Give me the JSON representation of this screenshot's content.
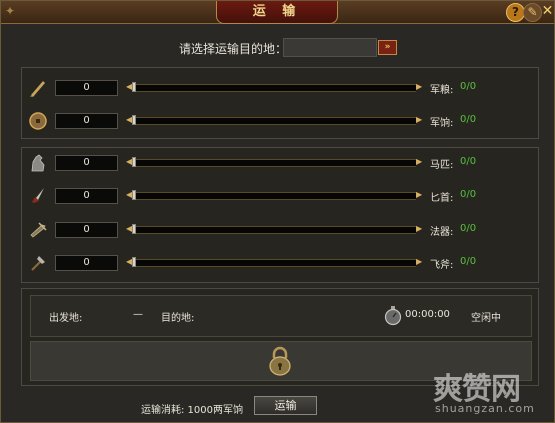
{
  "window": {
    "title": "运 输"
  },
  "destination": {
    "label": "请选择运输目的地：",
    "value": ""
  },
  "supplies": [
    {
      "name": "军粮:",
      "qty": "0",
      "value": "0/0",
      "icon": "brush-icon"
    },
    {
      "name": "军饷:",
      "qty": "0",
      "value": "0/0",
      "icon": "coin-icon"
    }
  ],
  "equipment": [
    {
      "name": "马匹:",
      "qty": "0",
      "value": "0/0",
      "icon": "horse-icon"
    },
    {
      "name": "匕首:",
      "qty": "0",
      "value": "0/0",
      "icon": "dagger-icon"
    },
    {
      "name": "法器:",
      "qty": "0",
      "value": "0/0",
      "icon": "crossbow-icon"
    },
    {
      "name": "飞斧:",
      "qty": "0",
      "value": "0/0",
      "icon": "axe-icon"
    }
  ],
  "status": {
    "origin_label": "出发地:",
    "origin_value": "—",
    "dest_label": "目的地:",
    "timer": "00:00:00",
    "state": "空闲中"
  },
  "footer": {
    "cost": "运输消耗: 1000两军饷",
    "button": "运输"
  },
  "watermark": {
    "big": "爽赞网",
    "small": "shuangzan.com"
  }
}
